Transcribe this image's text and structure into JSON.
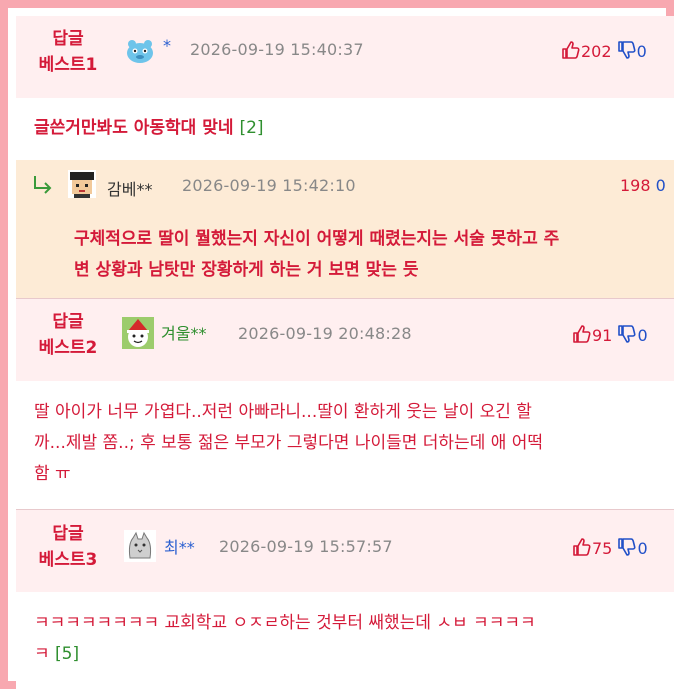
{
  "best1": {
    "label_line1": "답글",
    "label_line2": "베스트1",
    "nick": "*",
    "date": "2026-09-19 15:40:37",
    "up": "202",
    "down": "0",
    "body": "글쓴거만봐도 아동학대 맞네",
    "reply_count": "[2]"
  },
  "reply": {
    "nick": "감베**",
    "date": "2026-09-19 15:42:10",
    "up": "198",
    "down": "0",
    "body_line1": "구체적으로 딸이 뭘했는지 자신이 어떻게 때렸는지는 서술 못하고 주",
    "body_line2": "변 상황과 남탓만 장황하게 하는 거 보면 맞는 듯"
  },
  "best2": {
    "label_line1": "답글",
    "label_line2": "베스트2",
    "nick": "겨울**",
    "date": "2026-09-19 20:48:28",
    "up": "91",
    "down": "0",
    "body_line1": "딸 아이가 너무 가엽다..저런 아빠라니...딸이 환하게 웃는 날이 오긴 할",
    "body_line2": "까...제발 쫌..; 후 보통 젊은 부모가 그렇다면 나이들면 더하는데 애 어떡",
    "body_line3": "함 ㅠ"
  },
  "best3": {
    "label_line1": "답글",
    "label_line2": "베스트3",
    "nick": "최**",
    "date": "2026-09-19 15:57:57",
    "up": "75",
    "down": "0",
    "body_line1": "ㅋㅋㅋㅋㅋㅋㅋㅋ 교회학교 ㅇㅈㄹ하는 것부터 쌔했는데 ㅅㅂ ㅋㅋㅋㅋ",
    "body_line2": "ㅋ",
    "reply_count": "[5]"
  },
  "icons": {
    "thumbs_up": "thumbs-up-icon",
    "thumbs_down": "thumbs-down-icon",
    "reply_arrow": "reply-arrow-icon"
  }
}
